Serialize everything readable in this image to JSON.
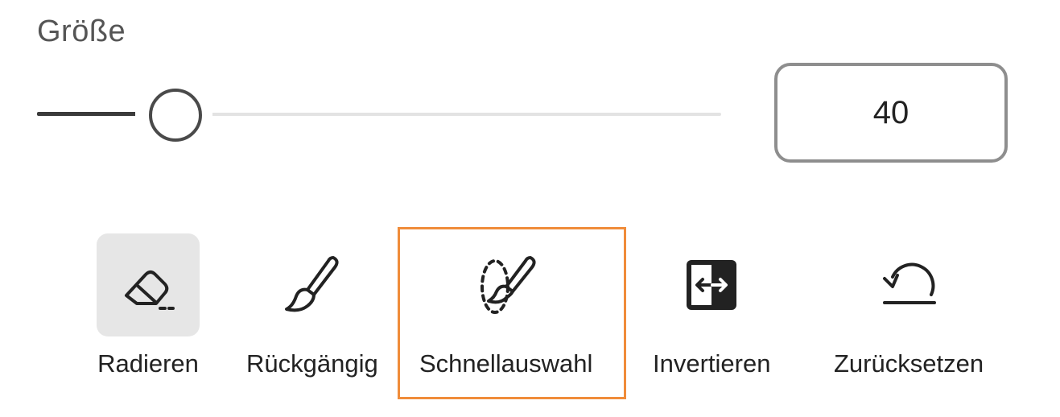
{
  "size": {
    "label": "Größe",
    "value": "40",
    "slider_fraction": 0.2
  },
  "tools": [
    {
      "label": "Radieren",
      "icon": "eraser-icon",
      "active": true
    },
    {
      "label": "Rückgängig",
      "icon": "brush-icon",
      "active": false
    },
    {
      "label": "Schnellauswahl",
      "icon": "quick-select-brush-icon",
      "active": false,
      "highlighted": true
    },
    {
      "label": "Invertieren",
      "icon": "invert-icon",
      "active": false
    },
    {
      "label": "Zurücksetzen",
      "icon": "reset-icon",
      "active": false
    }
  ],
  "colors": {
    "highlight": "#f08c3a",
    "active_bg": "#e6e6e6"
  }
}
